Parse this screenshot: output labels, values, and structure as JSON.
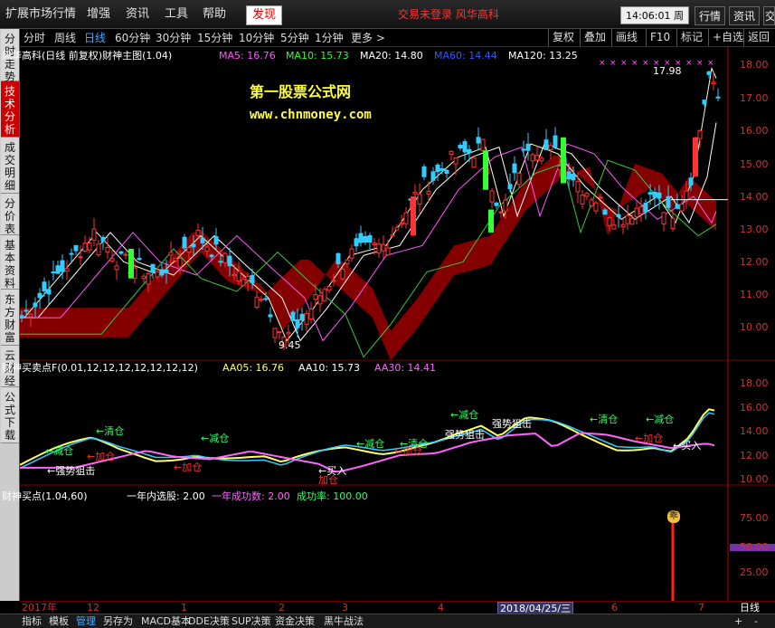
{
  "menu": {
    "items": [
      "扩展市场行情",
      "增强",
      "资讯",
      "工具",
      "帮助"
    ],
    "discover": "发现",
    "notice": "交易未登录   风华高科",
    "clock": "14:06:01 周四",
    "right_buttons": [
      "行情",
      "资讯",
      "交"
    ]
  },
  "periods": [
    "分时",
    "周线",
    "日线",
    "60分钟",
    "30分钟",
    "15分钟",
    "10分钟",
    "5分钟",
    "1分钟",
    "更多 >"
  ],
  "active_period": "日线",
  "toolbar_right": [
    "复权",
    "叠加",
    "画线",
    "F10",
    "标记",
    "+自选",
    "返回"
  ],
  "left_tabs": [
    "分时走势",
    "技术分析",
    "成交明细",
    "分价表",
    "基本资料",
    "东方财富",
    "云财经",
    "公式下载"
  ],
  "active_tab": "技术分析",
  "main_panel": {
    "title": "风华高科(日线 前复权)财神主图(1.04)",
    "ma": [
      {
        "label": "MA5: 16.76",
        "color": "#ff55ff"
      },
      {
        "label": "MA10: 15.73",
        "color": "#33ff33"
      },
      {
        "label": "MA20: 14.80",
        "color": "#ffffff"
      },
      {
        "label": "MA60: 14.44",
        "color": "#3355ff"
      },
      {
        "label": "MA120: 13.25",
        "color": "#ffffff"
      }
    ],
    "watermark_1": "第一股票公式网",
    "watermark_2": "www.chnmoney.com",
    "high_label": "17.98",
    "low_label": "9.45",
    "y_ticks": [
      "18.00",
      "17.00",
      "16.00",
      "15.00",
      "14.00",
      "13.00",
      "12.00",
      "11.00",
      "10.00"
    ]
  },
  "mid_panel": {
    "title": "财神买卖点F(0.01,12,12,12,12,12,12,12)",
    "legend": [
      {
        "label": "AA05: 16.76",
        "color": "#ffff66"
      },
      {
        "label": "AA10: 15.73",
        "color": "#ffffff"
      },
      {
        "label": "AA30: 14.41",
        "color": "#ff66ff"
      }
    ],
    "y_ticks": [
      "18.00",
      "16.00",
      "14.00",
      "12.00",
      "10.00"
    ],
    "signals_green": [
      "←减仓",
      "←清仓",
      "←减仓",
      "←减仓",
      "←清仓",
      "←减仓",
      "←清仓",
      "←减仓"
    ],
    "signals_red": [
      "←加仓",
      "←加仓",
      "加仓",
      "←加仓",
      "←加仓"
    ],
    "signals_white": [
      "←强势狙击",
      "强势狙击",
      "强势狙击",
      "←买入",
      "←买入"
    ]
  },
  "bottom_panel": {
    "title": "财神买点(1.04,60)",
    "stat1": "一年内选股: 2.00",
    "stat2": "一年成功数: 2.00",
    "stat3": "成功率: 100.00",
    "y_ticks": [
      "75.00",
      "50.00",
      "25.00"
    ],
    "marker": "乖"
  },
  "dates": [
    "2017年",
    "12",
    "1",
    "2",
    "3",
    "4",
    "2018/04/25/三",
    "6",
    "7"
  ],
  "period_label": "日线",
  "bottom_tabs": [
    "指标",
    "模板",
    "管理",
    "另存为",
    "MACD基本",
    "DDE决策",
    "SUP决策",
    "资金决策",
    "黑牛战法"
  ],
  "active_bottom_tab": "管理",
  "colors": {
    "up": "#ff3333",
    "down": "#33ccff",
    "axis": "#c00000",
    "ribbon": "#8b0000"
  }
}
